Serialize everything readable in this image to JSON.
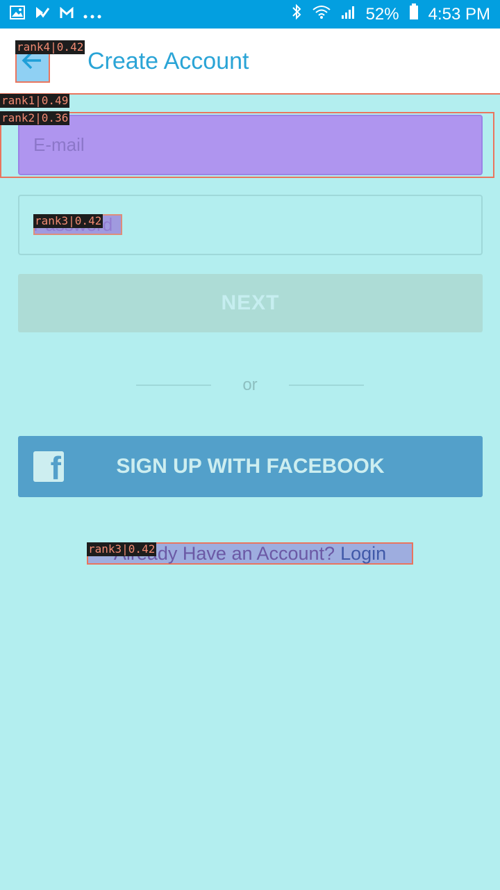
{
  "status_bar": {
    "battery": "52%",
    "time": "4:53 PM",
    "left_icons": [
      "gallery-icon",
      "check-icon",
      "gmail-icon",
      "more-icon"
    ],
    "right_icons": [
      "bluetooth-icon",
      "wifi-icon",
      "signal-icon",
      "battery-icon"
    ]
  },
  "header": {
    "title": "Create Account",
    "back_icon": "back-arrow-icon"
  },
  "form": {
    "email_placeholder": "E-mail",
    "password_placeholder": "Password",
    "next_label": "NEXT"
  },
  "divider": {
    "text": "or"
  },
  "facebook": {
    "label": "SIGN UP WITH FACEBOOK",
    "icon": "facebook-icon"
  },
  "login": {
    "prompt": "Already Have an Account?",
    "link": "Login"
  },
  "overlay_tags": {
    "back": "rank4|0.42",
    "header": "rank1|0.49",
    "email": "rank2|0.36",
    "password": "rank3|0.42",
    "login": "rank3|0.42"
  },
  "colors": {
    "status_bar": "#039fe0",
    "background": "#b3eeef",
    "accent": "#2aa4d6",
    "facebook": "#53a0ca",
    "highlight_border": "#e9755e"
  }
}
